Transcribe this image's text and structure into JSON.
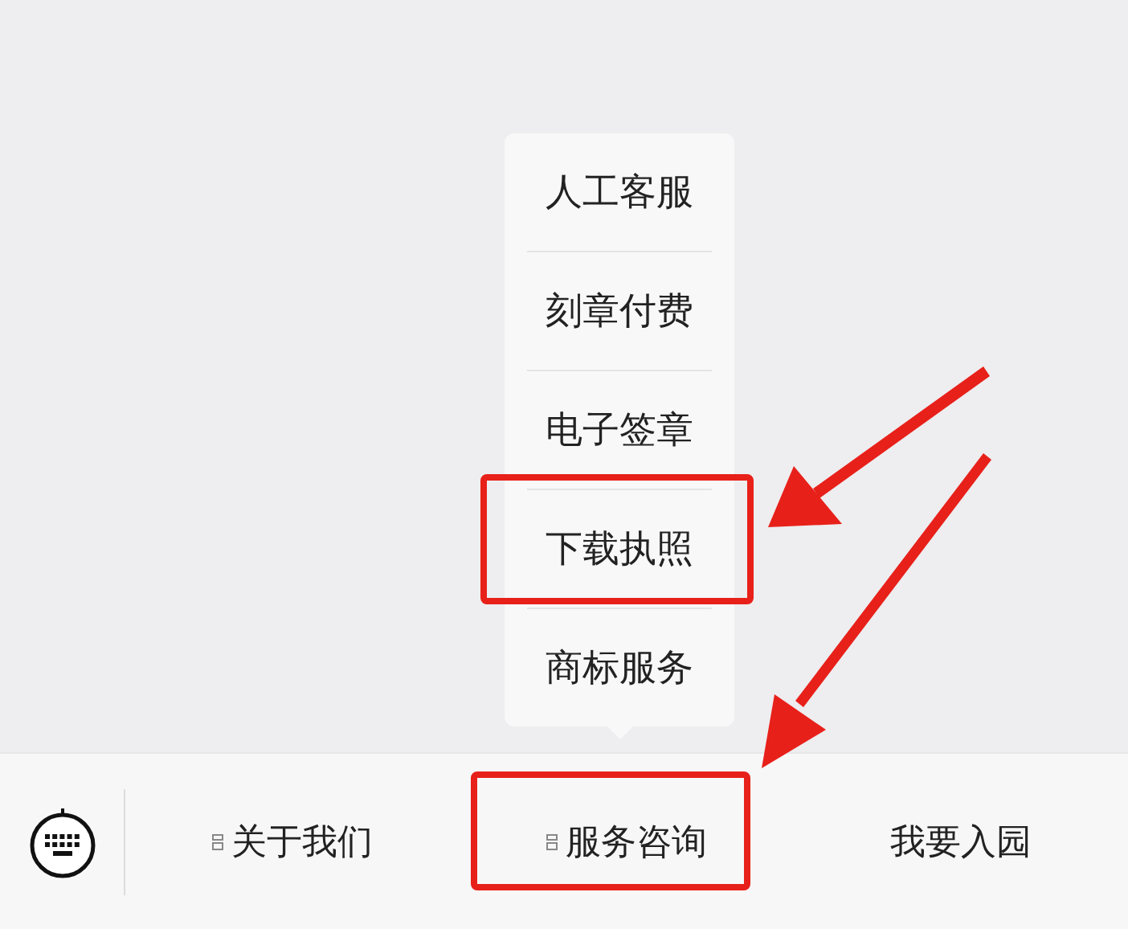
{
  "popup_menu": {
    "items": [
      {
        "label": "人工客服",
        "highlighted": false
      },
      {
        "label": "刻章付费",
        "highlighted": false
      },
      {
        "label": "电子签章",
        "highlighted": false
      },
      {
        "label": "下载执照",
        "highlighted": true
      },
      {
        "label": "商标服务",
        "highlighted": false
      }
    ]
  },
  "bottom_menu": {
    "items": [
      {
        "label": "关于我们",
        "has_submenu": true,
        "highlighted": false
      },
      {
        "label": "服务咨询",
        "has_submenu": true,
        "highlighted": true
      },
      {
        "label": "我要入园",
        "has_submenu": false,
        "highlighted": false
      }
    ]
  }
}
